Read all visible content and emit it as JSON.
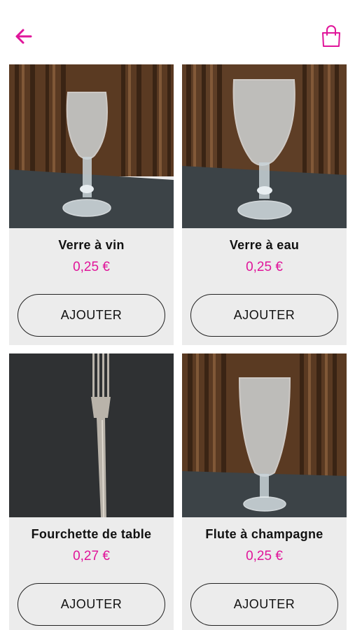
{
  "header": {
    "back_icon": "arrow-left-icon",
    "cart_icon": "shopping-bag-icon",
    "accent": "#e0159a"
  },
  "products": [
    {
      "name": "Verre à vin",
      "price": "0,25 €",
      "button": "AJOUTER",
      "image": "wine-glass"
    },
    {
      "name": "Verre à eau",
      "price": "0,25 €",
      "button": "AJOUTER",
      "image": "water-glass"
    },
    {
      "name": "Fourchette de table",
      "price": "0,27 €",
      "button": "AJOUTER",
      "image": "fork"
    },
    {
      "name": "Flute à champagne",
      "price": "0,25 €",
      "button": "AJOUTER",
      "image": "champagne-flute"
    }
  ]
}
